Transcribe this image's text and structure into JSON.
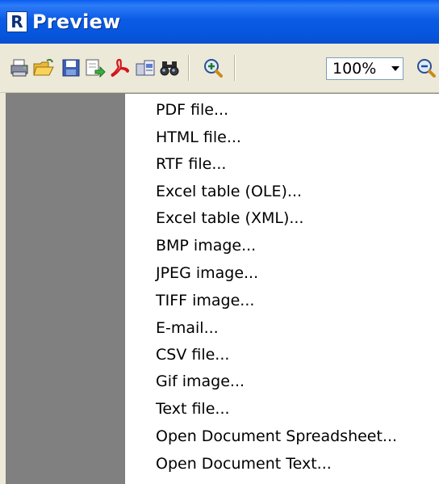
{
  "window": {
    "title": "Preview",
    "logo_letter": "R",
    "title_bar_color": "#0b5be5"
  },
  "toolbar": {
    "buttons": [
      {
        "name": "print-icon"
      },
      {
        "name": "open-folder-icon"
      },
      {
        "name": "save-icon"
      },
      {
        "name": "export-icon"
      },
      {
        "name": "pdf-icon"
      },
      {
        "name": "send-email-icon"
      },
      {
        "name": "find-binoculars-icon"
      },
      {
        "name": "zoom-in-icon"
      }
    ],
    "zoom_value": "100%"
  },
  "menu": {
    "items": [
      "PDF file...",
      "HTML file...",
      "RTF file...",
      "Excel table (OLE)...",
      "Excel table (XML)...",
      "BMP image...",
      "JPEG image...",
      "TIFF image...",
      "E-mail...",
      "CSV file...",
      "Gif image...",
      "Text file...",
      "Open Document Spreadsheet...",
      "Open Document Text..."
    ]
  }
}
